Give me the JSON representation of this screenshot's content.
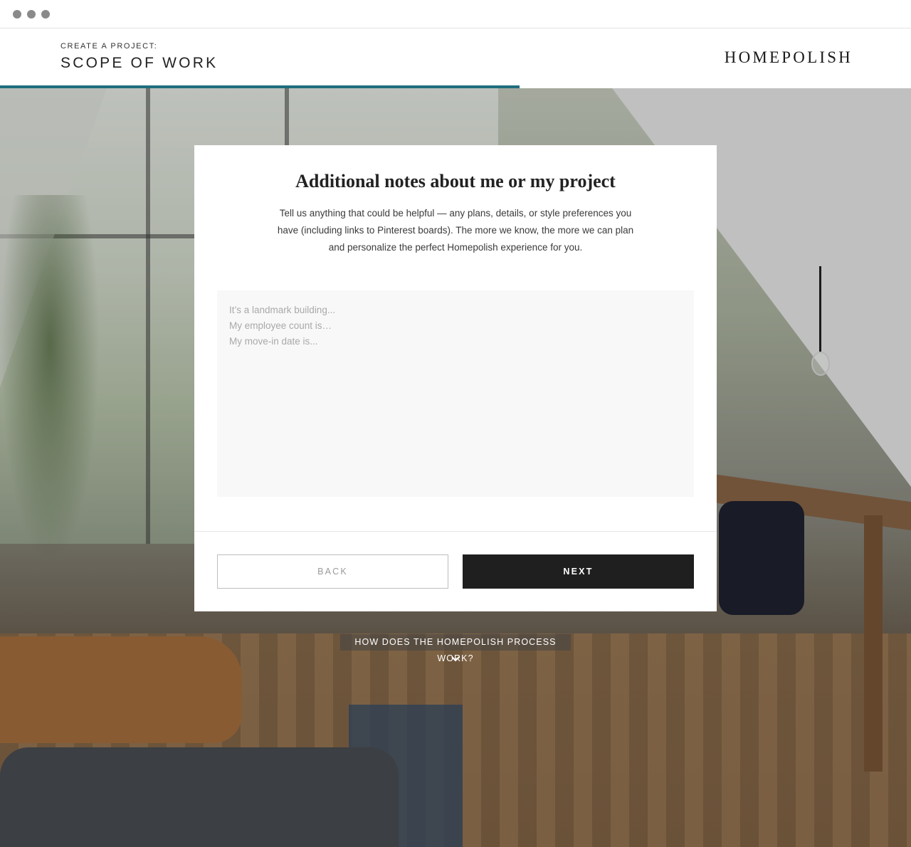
{
  "header": {
    "eyebrow": "CREATE A PROJECT:",
    "title": "SCOPE OF WORK",
    "logo": "HOMEPOLISH",
    "progress_percent": 57,
    "accent_color": "#1f6e7e"
  },
  "card": {
    "title": "Additional notes about me or my project",
    "description": "Tell us anything that could be helpful — any plans, details, or style preferences you have (including links to Pinterest boards). The more we know, the more we can plan and personalize the perfect Homepolish experience for you.",
    "notes_placeholder": "It’s a landmark building...\nMy employee count is…\nMy move-in date is...",
    "notes_value": "",
    "back_label": "BACK",
    "next_label": "NEXT"
  },
  "footer": {
    "how_label": "HOW DOES THE HOMEPOLISH PROCESS WORK?",
    "chevron_icon": "chevron-down-icon"
  },
  "chrome": {
    "window_dots": [
      "close",
      "minimize",
      "maximize"
    ]
  }
}
